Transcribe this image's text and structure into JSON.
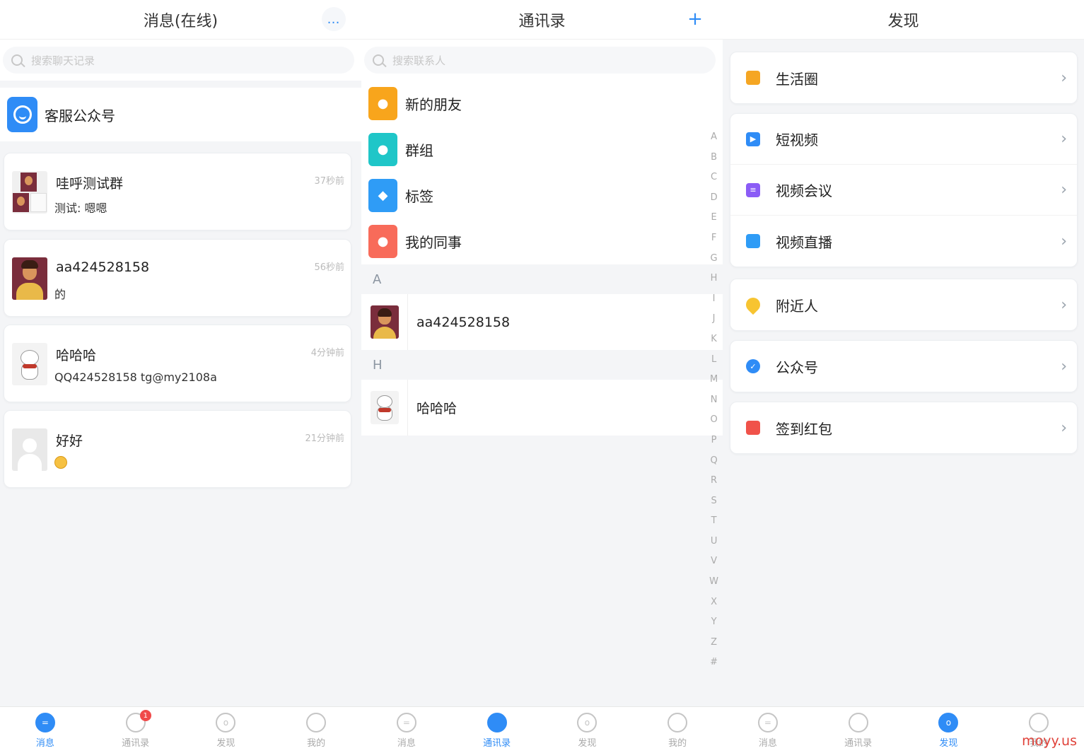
{
  "messages": {
    "title": "消息(在线)",
    "more_icon": "…",
    "search_placeholder": "搜索聊天记录",
    "service": "客服公众号",
    "chats": [
      {
        "name": "哇呼测试群",
        "preview": "测试: 嗯嗯",
        "time": "37秒前",
        "avatar": "group"
      },
      {
        "name": "aa424528158",
        "preview": "的",
        "time": "56秒前",
        "avatar": "person"
      },
      {
        "name": "哈哈哈",
        "preview": "QQ424528158 tg@my2108a",
        "time": "4分钟前",
        "avatar": "cat"
      },
      {
        "name": "好好",
        "preview": "",
        "time": "21分钟前",
        "avatar": "blank"
      }
    ],
    "emoji": "smile-emoji"
  },
  "contacts": {
    "title": "通讯录",
    "add_icon": "+",
    "search_placeholder": "搜索联系人",
    "entries": [
      {
        "label": "新的朋友",
        "color": "#f8a51c",
        "icon": "person-add-icon"
      },
      {
        "label": "群组",
        "color": "#1fc6c8",
        "icon": "group-icon"
      },
      {
        "label": "标签",
        "color": "#2f9cf6",
        "icon": "tag-icon"
      },
      {
        "label": "我的同事",
        "color": "#f86b5a",
        "icon": "colleague-icon"
      }
    ],
    "sections": [
      {
        "letter": "A",
        "name": "aa424528158"
      },
      {
        "letter": "H",
        "name": "哈哈哈"
      }
    ],
    "alphabet": [
      "A",
      "B",
      "C",
      "D",
      "E",
      "F",
      "G",
      "H",
      "I",
      "J",
      "K",
      "L",
      "M",
      "N",
      "O",
      "P",
      "Q",
      "R",
      "S",
      "T",
      "U",
      "V",
      "W",
      "X",
      "Y",
      "Z",
      "#"
    ]
  },
  "discover": {
    "title": "发现",
    "groups": [
      [
        {
          "label": "生活圈",
          "color": "#f5a623",
          "icon": "pinwheel-icon"
        }
      ],
      [
        {
          "label": "短视频",
          "color": "#2f8cf6",
          "icon": "play-icon"
        },
        {
          "label": "视频会议",
          "color": "#8b5cf6",
          "icon": "meeting-icon"
        },
        {
          "label": "视频直播",
          "color": "#2f9cf6",
          "icon": "live-icon"
        }
      ],
      [
        {
          "label": "附近人",
          "color": "#f7c431",
          "icon": "location-icon"
        }
      ],
      [
        {
          "label": "公众号",
          "color": "#2f8cf6",
          "icon": "verified-icon"
        }
      ],
      [
        {
          "label": "签到红包",
          "color": "#f0524a",
          "icon": "red-packet-icon"
        }
      ]
    ]
  },
  "tabs": {
    "messages": "消息",
    "contacts": "通讯录",
    "discover": "发现",
    "me": "我的",
    "badge": "1"
  },
  "watermark": "moyy.us"
}
